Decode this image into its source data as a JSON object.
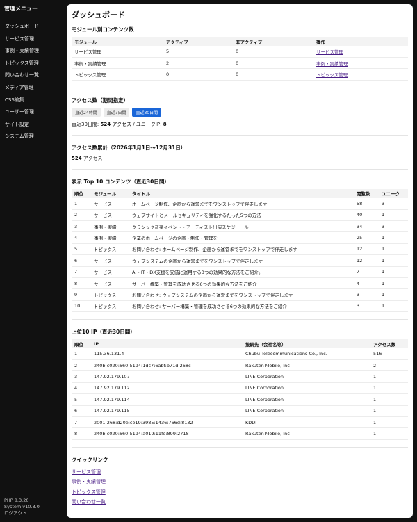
{
  "sidebar": {
    "title": "管理メニュー",
    "items": [
      "ダッシュボード",
      "サービス管理",
      "事例・実績管理",
      "トピックス管理",
      "問い合わせ一覧",
      "メディア管理",
      "CSS編集",
      "ユーザー管理",
      "サイト設定",
      "システム管理"
    ],
    "php_version": "PHP 8.3.20",
    "system_version": "System v10.3.0",
    "logout": "ログアウト"
  },
  "page_title": "ダッシュボード",
  "module_contents": {
    "heading": "モジュール別コンテンツ数",
    "columns": [
      "モジュール",
      "アクティブ",
      "非アクティブ",
      "操作"
    ],
    "rows": [
      {
        "module": "サービス管理",
        "active": "5",
        "inactive": "0",
        "action": "サービス管理"
      },
      {
        "module": "事例・実績管理",
        "active": "2",
        "inactive": "0",
        "action": "事例・実績管理"
      },
      {
        "module": "トピックス管理",
        "active": "0",
        "inactive": "0",
        "action": "トピックス管理"
      }
    ]
  },
  "access": {
    "heading": "アクセス数（期間指定）",
    "tabs": [
      "直近24時間",
      "直近7日間",
      "直近30日間"
    ],
    "active_tab": 2,
    "summary_prefix": "直近30日間: ",
    "access_count": "524",
    "summary_mid": " アクセス / ユニークIP: ",
    "unique_ip": "8"
  },
  "access_total": {
    "heading": "アクセス数累計（2026年1月1日〜12月31日）",
    "count": "524",
    "unit": " アクセス"
  },
  "top_content": {
    "heading": "表示 Top 10 コンテンツ（直近30日間）",
    "columns": [
      "順位",
      "モジュール",
      "タイトル",
      "閲覧数",
      "ユニーク"
    ],
    "rows": [
      {
        "rank": "1",
        "module": "サービス",
        "title": "ホームページ制作、企画から運営までをワンストップで伴走します",
        "views": "58",
        "unique": "3"
      },
      {
        "rank": "2",
        "module": "サービス",
        "title": "ウェブサイトとメールセキュリティを強化するたった5つの方法",
        "views": "40",
        "unique": "1"
      },
      {
        "rank": "3",
        "module": "事例・実績",
        "title": "クラシック音楽イベント・アーティスト出演スケジュール",
        "views": "34",
        "unique": "3"
      },
      {
        "rank": "4",
        "module": "事例・実績",
        "title": "企業のホームページの企画・制作・管理を",
        "views": "25",
        "unique": "1"
      },
      {
        "rank": "5",
        "module": "トピックス",
        "title": "お問い合わせ: ホームページ制作、企画から運営までをワンストップで伴走します",
        "views": "12",
        "unique": "1"
      },
      {
        "rank": "6",
        "module": "サービス",
        "title": "ウェブシステムの企画から運営までをワンストップで伴走します",
        "views": "12",
        "unique": "1"
      },
      {
        "rank": "7",
        "module": "サービス",
        "title": "AI・IT・DX支援を安価に運用する3つの効果的な方法をご紹介。",
        "views": "7",
        "unique": "1"
      },
      {
        "rank": "8",
        "module": "サービス",
        "title": "サーバー構築・管理を成功させる6つの効果的な方法をご紹介",
        "views": "4",
        "unique": "1"
      },
      {
        "rank": "9",
        "module": "トピックス",
        "title": "お問い合わせ: ウェブシステムの企画から運営までをワンストップで伴走します",
        "views": "3",
        "unique": "1"
      },
      {
        "rank": "10",
        "module": "トピックス",
        "title": "お問い合わせ: サーバー構築・管理を成功させる6つの効果的な方法をご紹介",
        "views": "3",
        "unique": "1"
      }
    ]
  },
  "top_ip": {
    "heading": "上位10 IP（直近30日間）",
    "columns": [
      "順位",
      "IP",
      "接続先（会社名等）",
      "アクセス数"
    ],
    "rows": [
      {
        "rank": "1",
        "ip": "115.36.131.4",
        "org": "Chubu Telecommunications Co., Inc.",
        "count": "516"
      },
      {
        "rank": "2",
        "ip": "240b:c020:660:5194:1dc7:6abf:b71d:268c",
        "org": "Rakuten Mobile, Inc",
        "count": "2"
      },
      {
        "rank": "3",
        "ip": "147.92.179.107",
        "org": "LINE Corporation",
        "count": "1"
      },
      {
        "rank": "4",
        "ip": "147.92.179.112",
        "org": "LINE Corporation",
        "count": "1"
      },
      {
        "rank": "5",
        "ip": "147.92.179.114",
        "org": "LINE Corporation",
        "count": "1"
      },
      {
        "rank": "6",
        "ip": "147.92.179.115",
        "org": "LINE Corporation",
        "count": "1"
      },
      {
        "rank": "7",
        "ip": "2001:268:d20e:ce19:3985:1436:766d:8132",
        "org": "KDDI",
        "count": "1"
      },
      {
        "rank": "8",
        "ip": "240b:c020:660:5194:a019:11fe:899:2718",
        "org": "Rakuten Mobile, Inc",
        "count": "1"
      }
    ]
  },
  "quick_links": {
    "heading": "クイックリンク",
    "items": [
      "サービス管理",
      "事例・実績管理",
      "トピックス管理",
      "問い合わせ一覧"
    ]
  }
}
